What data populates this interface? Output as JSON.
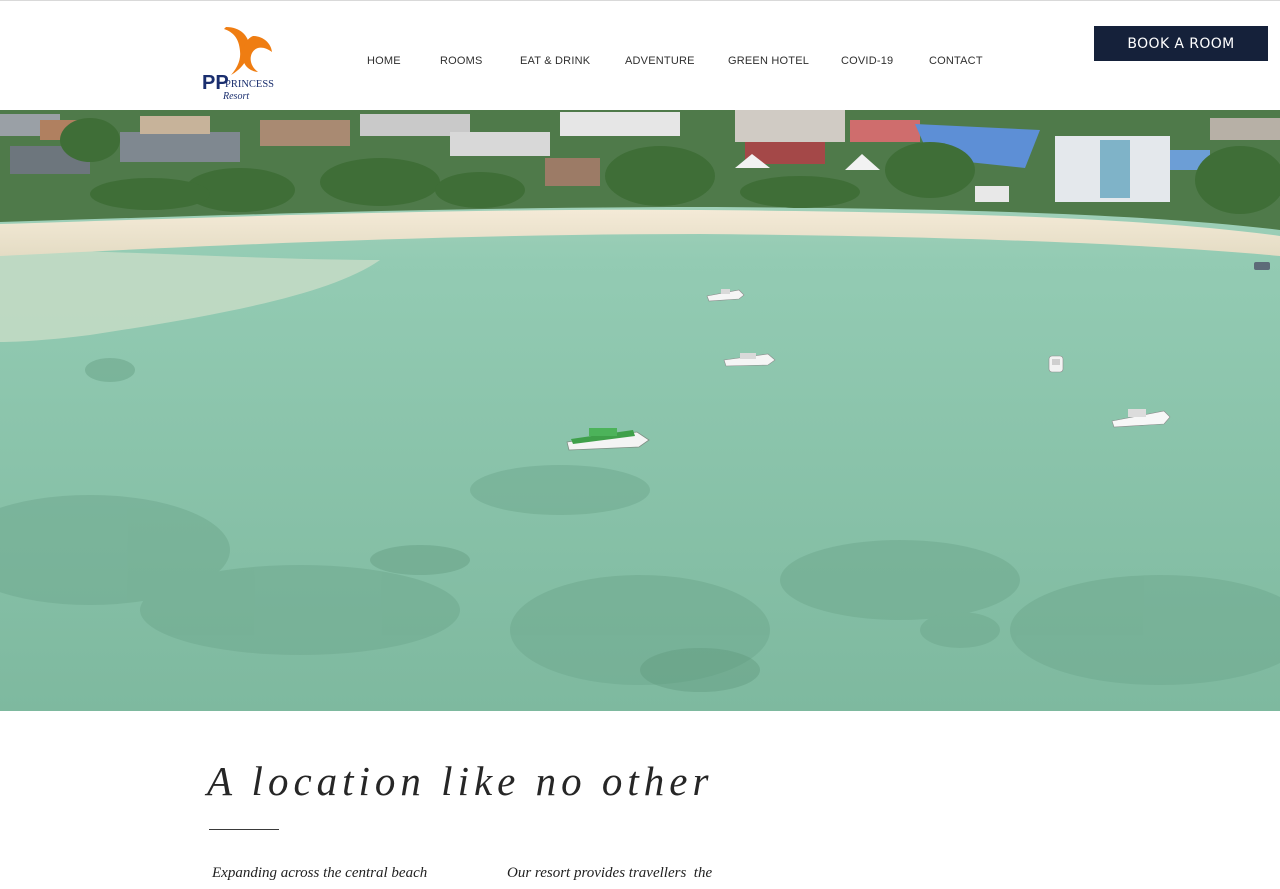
{
  "brand": {
    "logo_main": "PP",
    "logo_sub": "PRINCESS",
    "logo_script": "Resort",
    "accent_color": "#ef7d12",
    "navy_color": "#1a2e6e"
  },
  "nav": {
    "items": [
      "HOME",
      "ROOMS",
      "EAT & DRINK",
      "ADVENTURE",
      "GREEN HOTEL",
      "COVID-19",
      "CONTACT"
    ]
  },
  "book_button": {
    "label": "BOOK A ROOM",
    "color": "#15213a"
  },
  "hero": {
    "subject": "aerial view of beach bay with boats"
  },
  "intro": {
    "title": "A location like no other",
    "paragraph_1": "Expanding across the central beach",
    "paragraph_2": "Our resort provides travellers  the"
  }
}
